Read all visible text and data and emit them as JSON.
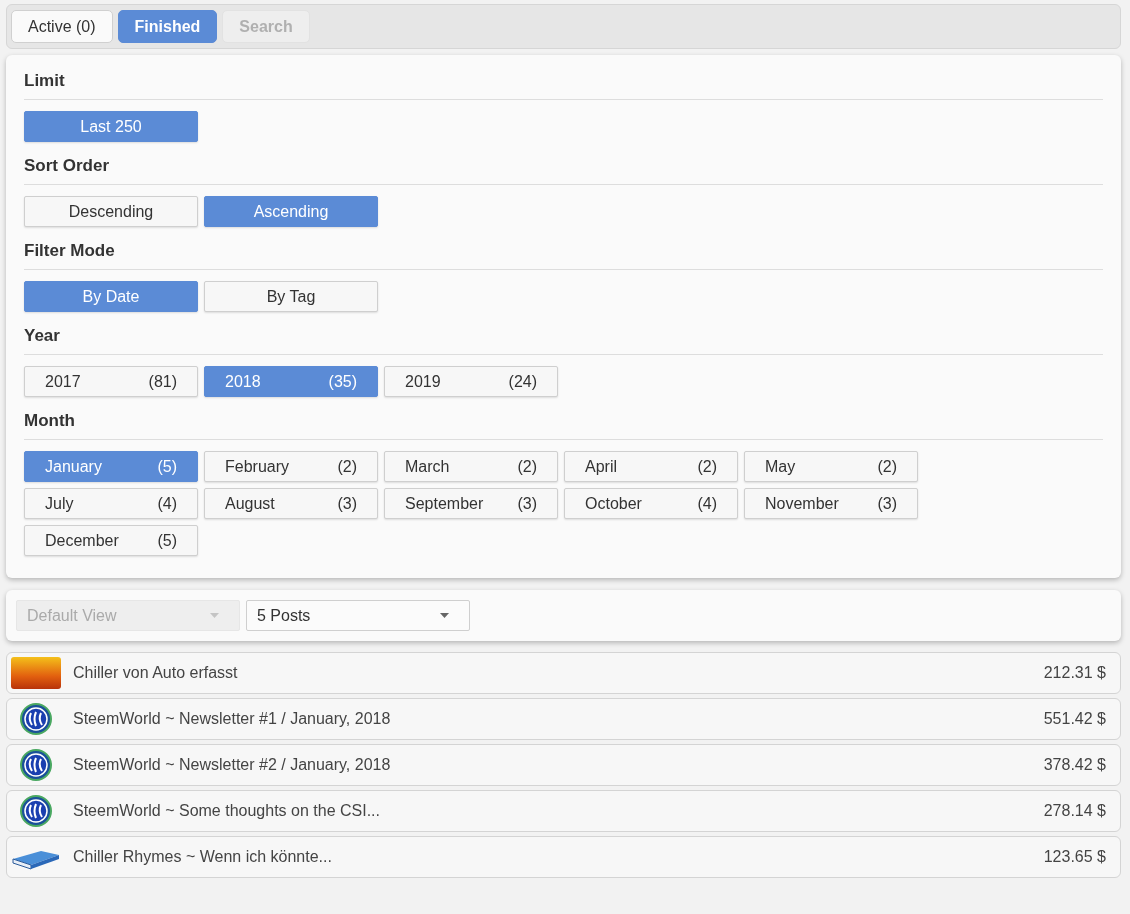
{
  "tabs": [
    {
      "label": "Active (0)",
      "selected": false,
      "disabled": false
    },
    {
      "label": "Finished",
      "selected": true,
      "disabled": false
    },
    {
      "label": "Search",
      "selected": false,
      "disabled": true
    }
  ],
  "filters": [
    {
      "title": "Limit",
      "options": [
        {
          "label": "Last 250",
          "selected": true
        }
      ]
    },
    {
      "title": "Sort Order",
      "options": [
        {
          "label": "Descending",
          "selected": false
        },
        {
          "label": "Ascending",
          "selected": true
        }
      ]
    },
    {
      "title": "Filter Mode",
      "options": [
        {
          "label": "By Date",
          "selected": true
        },
        {
          "label": "By Tag",
          "selected": false
        }
      ]
    },
    {
      "title": "Year",
      "options": [
        {
          "label": "2017",
          "count": "(81)",
          "selected": false
        },
        {
          "label": "2018",
          "count": "(35)",
          "selected": true
        },
        {
          "label": "2019",
          "count": "(24)",
          "selected": false
        }
      ]
    },
    {
      "title": "Month",
      "options": [
        {
          "label": "January",
          "count": "(5)",
          "selected": true
        },
        {
          "label": "February",
          "count": "(2)",
          "selected": false
        },
        {
          "label": "March",
          "count": "(2)",
          "selected": false
        },
        {
          "label": "April",
          "count": "(2)",
          "selected": false
        },
        {
          "label": "May",
          "count": "(2)",
          "selected": false
        },
        {
          "label": "July",
          "count": "(4)",
          "selected": false
        },
        {
          "label": "August",
          "count": "(3)",
          "selected": false
        },
        {
          "label": "September",
          "count": "(3)",
          "selected": false
        },
        {
          "label": "October",
          "count": "(4)",
          "selected": false
        },
        {
          "label": "November",
          "count": "(3)",
          "selected": false
        },
        {
          "label": "December",
          "count": "(5)",
          "selected": false
        }
      ]
    }
  ],
  "dropdowns": [
    {
      "value": "Default View",
      "disabled": true
    },
    {
      "value": "5 Posts",
      "disabled": false
    }
  ],
  "posts": [
    {
      "kind": "photo",
      "title": "Chiller von Auto erfasst",
      "value": "212.31 $"
    },
    {
      "kind": "steem",
      "title": "SteemWorld ~ Newsletter #1 / January, 2018",
      "value": "551.42 $"
    },
    {
      "kind": "steem",
      "title": "SteemWorld ~ Newsletter #2 / January, 2018",
      "value": "378.42 $"
    },
    {
      "kind": "steem",
      "title": "SteemWorld ~ Some thoughts on the CSI...",
      "value": "278.14 $"
    },
    {
      "kind": "book",
      "title": "Chiller Rhymes ~ Wenn ich könnte...",
      "value": "123.65 $"
    }
  ]
}
